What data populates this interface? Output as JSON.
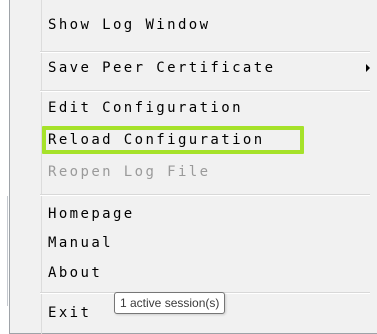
{
  "menu": {
    "items": [
      {
        "label": "Show Log Window",
        "enabled": true
      },
      {
        "label": "Save Peer Certificate",
        "enabled": true,
        "has_submenu": true
      },
      {
        "label": "Edit Configuration",
        "enabled": true
      },
      {
        "label": "Reload Configuration",
        "enabled": true,
        "highlighted": true
      },
      {
        "label": "Reopen Log File",
        "enabled": false
      },
      {
        "label": "Homepage",
        "enabled": true
      },
      {
        "label": "Manual",
        "enabled": true
      },
      {
        "label": "About",
        "enabled": true
      },
      {
        "label": "Exit",
        "enabled": true
      }
    ]
  },
  "tooltip": {
    "text": "1 active session(s)"
  },
  "colors": {
    "highlight_border": "#a6e22a",
    "menu_background": "#f1f1f1",
    "disabled_text": "#9a9a9a"
  },
  "icons": {
    "submenu": "chevron-right-icon"
  }
}
